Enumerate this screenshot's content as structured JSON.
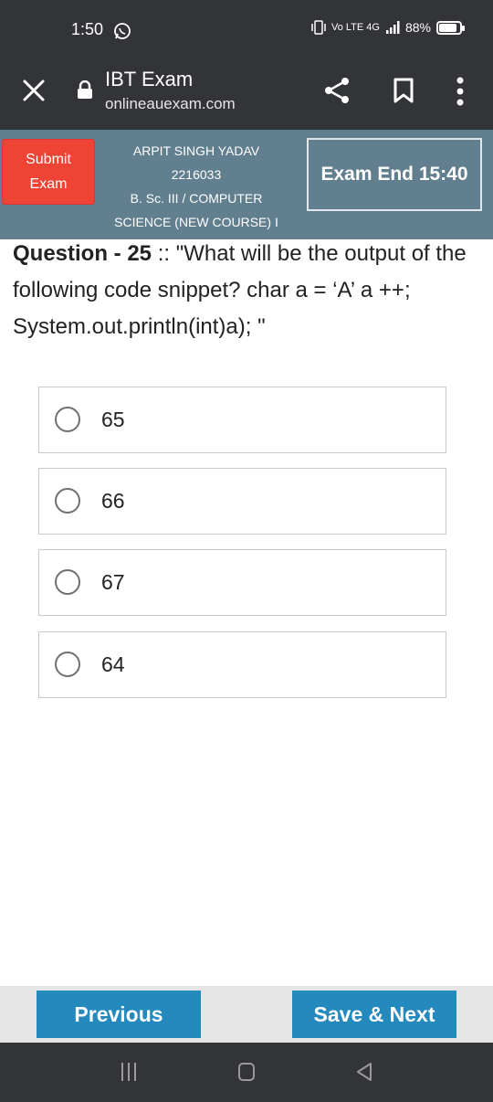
{
  "status": {
    "time": "1:50",
    "network": "Vo LTE 4G",
    "battery": "88%",
    "battery_level": 0.88
  },
  "browser": {
    "title": "IBT Exam",
    "url": "onlineauexam.com"
  },
  "exam": {
    "submit_line1": "Submit",
    "submit_line2": "Exam",
    "student_name": "ARPIT SINGH YADAV",
    "student_id": "2216033",
    "course_line1": "B. Sc. III / COMPUTER",
    "course_line2": "SCIENCE (NEW COURSE) I",
    "timer_label": "Exam End 15:40"
  },
  "question": {
    "number_label": "Question - 25",
    "separator": " :: ",
    "text": "\"What will be the output of the following code snippet? char a = ‘A’ a ++; System.out.println(int)a); \""
  },
  "options": [
    {
      "label": "65"
    },
    {
      "label": "66"
    },
    {
      "label": "67"
    },
    {
      "label": "64"
    }
  ],
  "nav": {
    "previous_label": "Previous",
    "next_label": "Save & Next"
  },
  "colors": {
    "header_bg": "#617f8f",
    "submit_red": "#ef4336",
    "button_blue": "#2489bd",
    "system_bar": "#333437"
  },
  "icons": {
    "close": "close-icon",
    "lock": "lock-icon",
    "share": "share-icon",
    "bookmark": "bookmark-icon",
    "menu": "more-vert-icon"
  }
}
